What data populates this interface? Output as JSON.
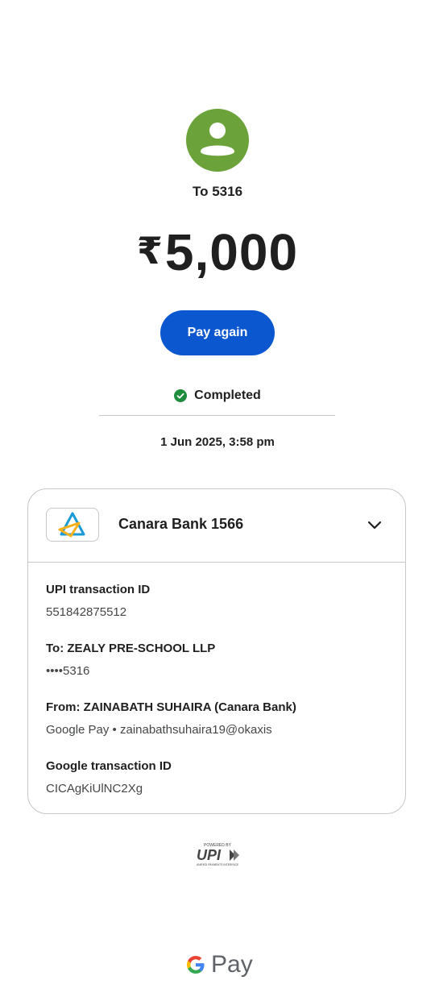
{
  "recipient": {
    "to_label": "To 5316"
  },
  "payment": {
    "currency_symbol": "₹",
    "amount": "5,000"
  },
  "actions": {
    "pay_again_label": "Pay again"
  },
  "status": {
    "label": "Completed",
    "color": "#1e8e3e"
  },
  "datetime": "1 Jun 2025, 3:58 pm",
  "bank": {
    "name": "Canara Bank 1566"
  },
  "details": {
    "upi_txn_label": "UPI transaction ID",
    "upi_txn_value": "551842875512",
    "to_label": "To: ZEALY PRE-SCHOOL LLP",
    "to_value": "••••5316",
    "from_label": "From: ZAINABATH  SUHAIRA (Canara Bank)",
    "from_value": "Google Pay • zainabathsuhaira19@okaxis",
    "google_txn_label": "Google transaction ID",
    "google_txn_value": "CICAgKiUlNC2Xg"
  },
  "footer": {
    "powered_by": "POWERED BY",
    "upi_text": "UPI",
    "upi_tagline": "UNIFIED PAYMENTS INTERFACE",
    "brand_text": "Pay"
  },
  "colors": {
    "accent": "#0b57d0",
    "avatar_bg": "#6ba33a"
  }
}
